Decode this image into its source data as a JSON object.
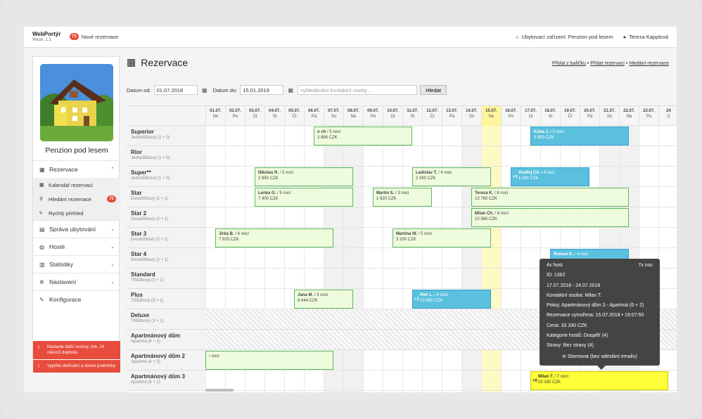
{
  "app": {
    "name": "WebPortýr",
    "version": "Verze: 1.1",
    "new_count": "71",
    "new_label": "Nové rezervace",
    "facility": "Ubytovací zařízení: Penzion pod lesem",
    "user": "Tereza Kapplová"
  },
  "sidebar": {
    "hotel": "Penzion pod lesem",
    "items": [
      {
        "label": "Rezervace",
        "icon": "calendar-icon",
        "chev": "⌃"
      },
      {
        "label": "Správa ubytování",
        "icon": "building-icon",
        "chev": "⌄"
      },
      {
        "label": "Hosté",
        "icon": "users-icon",
        "chev": "⌄"
      },
      {
        "label": "Statistiky",
        "icon": "bar-chart-icon",
        "chev": "⌄"
      },
      {
        "label": "Nastavení",
        "icon": "gear-icon",
        "chev": "⌄"
      },
      {
        "label": "Konfigurace",
        "icon": "wrench-icon",
        "chev": ""
      }
    ],
    "subitems": [
      {
        "label": "Kalendář rezervací",
        "icon": "calendar-icon"
      },
      {
        "label": "Hledání rezervace",
        "icon": "search-icon",
        "badge": "71"
      },
      {
        "label": "Rychlý přehled",
        "icon": "bolt-icon"
      }
    ],
    "alerts": [
      "Nastavte další sezóny, min. 24 měsíců dopředu.",
      "Vyplňte obchodní a storno podmínky"
    ]
  },
  "main": {
    "title": "Rezervace",
    "links": [
      "Přidat z balíčku",
      "Přidat rezervaci",
      "Hledání rezervace"
    ],
    "date_from_label": "Datum od:",
    "date_from": "01.07.2018",
    "date_to_label": "Datum do:",
    "date_to": "15.01.2019",
    "search_placeholder": "vyhledávání kontaktní osoby...",
    "search_button": "Hledat"
  },
  "calendar": {
    "days": [
      [
        "01.07.",
        "Ne"
      ],
      [
        "02.07.",
        "Po"
      ],
      [
        "03.07.",
        "Út"
      ],
      [
        "04.07.",
        "St"
      ],
      [
        "05.07.",
        "Čt"
      ],
      [
        "06.07.",
        "Pá"
      ],
      [
        "07.07.",
        "So"
      ],
      [
        "08.07.",
        "Ne"
      ],
      [
        "09.07.",
        "Po"
      ],
      [
        "10.07.",
        "Út"
      ],
      [
        "11.07.",
        "St"
      ],
      [
        "12.07.",
        "Čt"
      ],
      [
        "13.07.",
        "Pá"
      ],
      [
        "14.07.",
        "So"
      ],
      [
        "15.07.",
        "Ne"
      ],
      [
        "16.07.",
        "Po"
      ],
      [
        "17.07.",
        "Út"
      ],
      [
        "18.07.",
        "St"
      ],
      [
        "19.07.",
        "Čt"
      ],
      [
        "20.07.",
        "Pá"
      ],
      [
        "21.07.",
        "So"
      ],
      [
        "22.07.",
        "Ne"
      ],
      [
        "23.07.",
        "Po"
      ],
      [
        "24",
        "Ú"
      ]
    ],
    "rooms": [
      {
        "name": "Superior",
        "type": "Jednolůžkový (1 + 0)"
      },
      {
        "name": "Rior",
        "type": "Jednolůžkový (1 + 0)"
      },
      {
        "name": "Super**",
        "type": "Jednolůžkový (1 + 0)"
      },
      {
        "name": "Star",
        "type": "Dvoulůžkový (2 + 1)"
      },
      {
        "name": "Star 2",
        "type": "Dvoulůžkový (2 + 1)"
      },
      {
        "name": "Star 3",
        "type": "Dvoulůžkový (2 + 1)"
      },
      {
        "name": "Star 4",
        "type": "Dvoulůžkový (2 + 1)"
      },
      {
        "name": "Standard",
        "type": "Třílůžkový (3 + 1)"
      },
      {
        "name": "Plus",
        "type": "Třílůžkový (3 + 1)"
      },
      {
        "name": "Deluxe",
        "type": "Třílůžkový (3 + 1)"
      },
      {
        "name": "Apartmánový dům",
        "type": "Apartmá (6 + 2)"
      },
      {
        "name": "Apartmánový dům 2",
        "type": "Apartmá (6 + 2)"
      },
      {
        "name": "Apartmánový dům 3",
        "type": "Apartmá (6 + 2)"
      }
    ],
    "reservations": [
      {
        "name": "o ch",
        "nights": " / 5 nocí",
        "price": "2 894 CZK",
        "color": "green"
      },
      {
        "name": "Kuba J.",
        "nights": " / 5 nocí",
        "price": "2 950 CZK",
        "color": "blue"
      },
      {
        "name": "Nikolas R.",
        "nights": " / 5 nocí",
        "price": "2 950 CZK",
        "color": "green"
      },
      {
        "name": "Ladislav T.",
        "nights": " / 4 noci",
        "price": "2 390 CZK",
        "color": "green"
      },
      {
        "name": "Ondřej Ch.",
        "nights": " / 4 noci",
        "price": "1 290 CZK",
        "color": "blue",
        "plus": "+1"
      },
      {
        "name": "Lenka G.",
        "nights": " / 5 nocí",
        "price": "7 900 CZK",
        "color": "green"
      },
      {
        "name": "Martin S.",
        "nights": " / 3 noci",
        "price": "1 920 CZK",
        "color": "green"
      },
      {
        "name": "Tereza K.",
        "nights": " / 8 nocí",
        "price": "13 760 CZK",
        "color": "green"
      },
      {
        "name": "Milan Ch.",
        "nights": " / 8 nocí",
        "price": "10 560 CZK",
        "color": "green"
      },
      {
        "name": "Jirka B.",
        "nights": " / 6 nocí",
        "price": "7 920 CZK",
        "color": "green"
      },
      {
        "name": "Martina W.",
        "nights": " / 5 nocí",
        "price": "3 200 CZK",
        "color": "green"
      },
      {
        "name": "Roman K.",
        "nights": " / 4 noci",
        "price": "",
        "color": "blue"
      },
      {
        "name": "Jana M.",
        "nights": " / 3 noci",
        "price": "6 644 CZK",
        "color": "green"
      },
      {
        "name": "Petr L.",
        "nights": " / 4 noci",
        "price": "13 580 CZK",
        "color": "blue",
        "plus": "+1"
      },
      {
        "name": "",
        "nights": "› noci",
        "price": "",
        "color": "green"
      },
      {
        "name": "Milan T.",
        "nights": " / 7 nocí",
        "price": "33 330 CZK",
        "color": "yellow",
        "plus": "+6"
      }
    ]
  },
  "tooltip": {
    "guests": "4x host",
    "nights": "7x noc",
    "id": "ID: 1362",
    "dates": "17.07.2018 - 24.07.2018",
    "contact": "Kontaktní osoba: Milan T.",
    "room": "Pokoj: Apartmánový dům 3 - Apartmá (6 + 2)",
    "created": "Rezervace vytvořena: 15.07.2018 • 19:07:55",
    "price": "Cena: 33 330 CZK",
    "category": "Kategorie hostů: Dospělí (4)",
    "board": "Stravy: Bez stravy (4)",
    "cancel": "⊘ Stornovat (bez odeslání emailu)"
  }
}
